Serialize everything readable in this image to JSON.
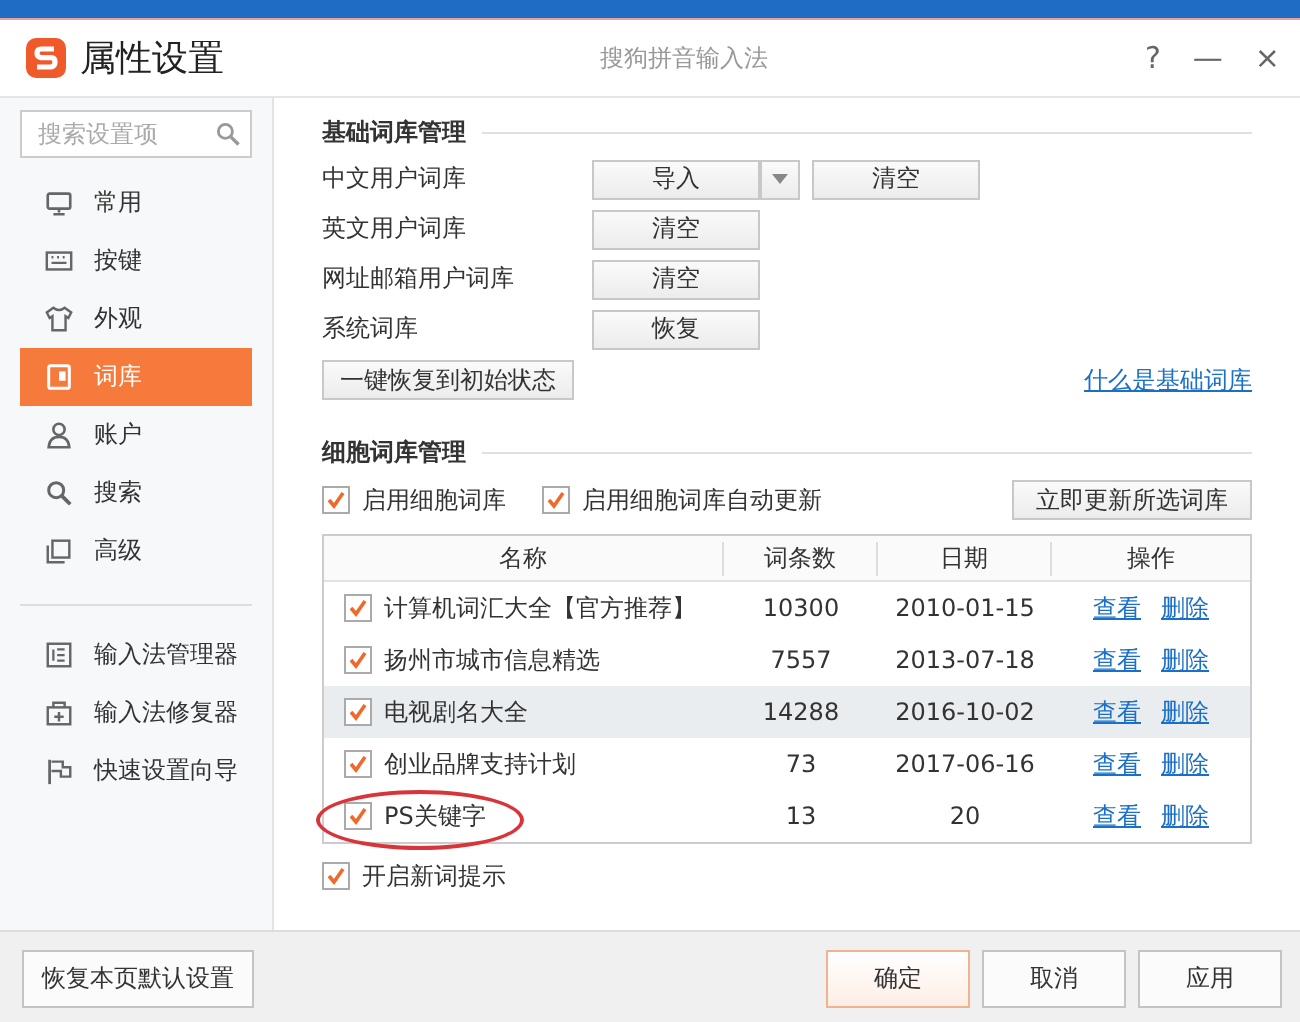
{
  "window": {
    "title": "属性设置",
    "subtitle": "搜狗拼音输入法",
    "controls": [
      "?",
      "—",
      "×"
    ]
  },
  "sidebar": {
    "search": {
      "placeholder": "搜索设置项"
    },
    "items": [
      {
        "label": "常用",
        "kind": "monitor",
        "selected": false
      },
      {
        "label": "按键",
        "kind": "keyboard",
        "selected": false
      },
      {
        "label": "外观",
        "kind": "shirt",
        "selected": false
      },
      {
        "label": "词库",
        "kind": "book",
        "selected": true
      },
      {
        "label": "账户",
        "kind": "person",
        "selected": false
      },
      {
        "label": "搜索",
        "kind": "search",
        "selected": false
      },
      {
        "label": "高级",
        "kind": "advanced",
        "selected": false
      }
    ],
    "tools": [
      {
        "label": "输入法管理器",
        "kind": "list"
      },
      {
        "label": "输入法修复器",
        "kind": "repair"
      },
      {
        "label": "快速设置向导",
        "kind": "flag"
      }
    ]
  },
  "basic": {
    "title": "基础词库管理",
    "rows": [
      {
        "label": "中文用户词库",
        "buttons": [
          {
            "label": "导入",
            "kind": "split"
          },
          {
            "label": "清空",
            "kind": "wide"
          }
        ]
      },
      {
        "label": "英文用户词库",
        "buttons": [
          {
            "label": "清空",
            "kind": "plain"
          }
        ]
      },
      {
        "label": "网址邮箱用户词库",
        "buttons": [
          {
            "label": "清空",
            "kind": "plain"
          }
        ]
      },
      {
        "label": "系统词库",
        "buttons": [
          {
            "label": "恢复",
            "kind": "plain"
          }
        ]
      }
    ],
    "reset_button": "一键恢复到初始状态",
    "help_link": "什么是基础词库"
  },
  "cell": {
    "title": "细胞词库管理",
    "options": [
      {
        "label": "启用细胞词库",
        "checked": true
      },
      {
        "label": "启用细胞词库自动更新",
        "checked": true
      }
    ],
    "update_button": "立即更新所选词库",
    "table": {
      "columns": [
        "名称",
        "词条数",
        "日期",
        "操作"
      ],
      "rows": [
        {
          "checked": true,
          "name": "计算机词汇大全【官方推荐】",
          "count": "10300",
          "date": "2010-01-15",
          "actions": [
            "查看",
            "删除"
          ],
          "selected": false,
          "circled": false
        },
        {
          "checked": true,
          "name": "扬州市城市信息精选",
          "count": "7557",
          "date": "2013-07-18",
          "actions": [
            "查看",
            "删除"
          ],
          "selected": false,
          "circled": false
        },
        {
          "checked": true,
          "name": "电视剧名大全",
          "count": "14288",
          "date": "2016-10-02",
          "actions": [
            "查看",
            "删除"
          ],
          "selected": true,
          "circled": false
        },
        {
          "checked": true,
          "name": "创业品牌支持计划",
          "count": "73",
          "date": "2017-06-16",
          "actions": [
            "查看",
            "删除"
          ],
          "selected": false,
          "circled": false
        },
        {
          "checked": true,
          "name": "PS关键字",
          "count": "13",
          "date": "20",
          "actions": [
            "查看",
            "删除"
          ],
          "selected": false,
          "circled": true
        }
      ]
    },
    "new_word_tip": {
      "label": "开启新词提示",
      "checked": true
    }
  },
  "footer": {
    "restore_button": "恢复本页默认设置",
    "buttons": [
      {
        "label": "确定",
        "kind": "primary"
      },
      {
        "label": "取消",
        "kind": "normal"
      },
      {
        "label": "应用",
        "kind": "normal"
      }
    ]
  }
}
